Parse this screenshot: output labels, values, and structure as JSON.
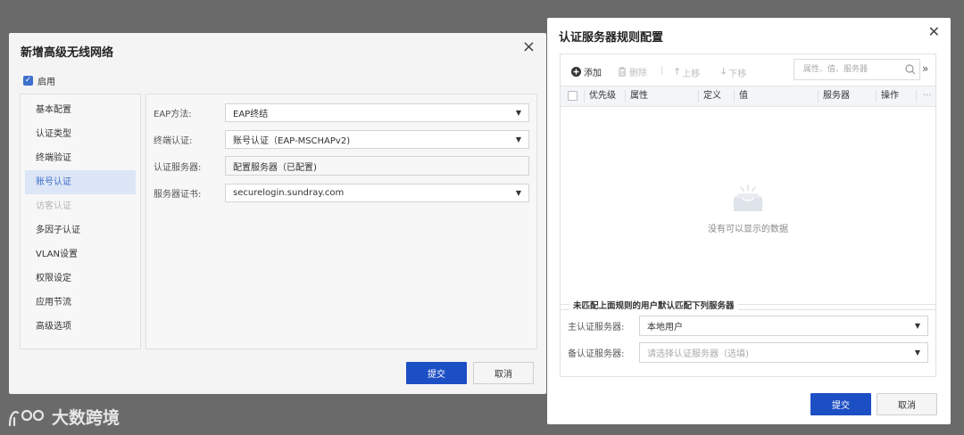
{
  "bg_dialog": {
    "title": "新增高级无线网络",
    "close": "×",
    "enable_label": "启用",
    "enable_checked": true,
    "sidebar": [
      {
        "label": "基本配置",
        "state": "normal"
      },
      {
        "label": "认证类型",
        "state": "normal"
      },
      {
        "label": "终端验证",
        "state": "normal"
      },
      {
        "label": "账号认证",
        "state": "active"
      },
      {
        "label": "访客认证",
        "state": "disabled"
      },
      {
        "label": "多因子认证",
        "state": "normal"
      },
      {
        "label": "VLAN设置",
        "state": "normal"
      },
      {
        "label": "权限设定",
        "state": "normal"
      },
      {
        "label": "应用节流",
        "state": "normal"
      },
      {
        "label": "高级选项",
        "state": "normal"
      }
    ],
    "form": {
      "eap_method": {
        "label": "EAP方法:",
        "value": "EAP终结"
      },
      "terminal_auth": {
        "label": "终端认证:",
        "value": "账号认证（EAP-MSCHAPv2)"
      },
      "auth_server": {
        "label": "认证服务器:",
        "value": "配置服务器（已配置)"
      },
      "server_cert": {
        "label": "服务器证书:",
        "value": "securelogin.sundray.com"
      }
    },
    "submit": "提交",
    "cancel": "取消"
  },
  "watermark": {
    "text": "大数跨境"
  },
  "modal": {
    "title": "认证服务器规则配置",
    "close": "✕",
    "toolbar": {
      "add": "添加",
      "delete": "删除",
      "move_up": "上移",
      "move_down": "下移",
      "search_placeholder": "属性、值、服务器",
      "more": "»"
    },
    "columns": {
      "priority": "优先级",
      "attribute": "属性",
      "definition": "定义",
      "value": "值",
      "server": "服务器",
      "action": "操作",
      "more": "···"
    },
    "empty_text": "没有可以显示的数据",
    "fallback": {
      "legend": "未匹配上面规则的用户默认匹配下列服务器",
      "primary_label": "主认证服务器:",
      "primary_value": "本地用户",
      "backup_label": "备认证服务器:",
      "backup_placeholder": "请选择认证服务器（选填)"
    },
    "submit": "提交",
    "cancel": "取消"
  },
  "colors": {
    "primary": "#1d4fc4",
    "overlay": "#6a6a6a",
    "active_bg": "#dde6f6"
  }
}
